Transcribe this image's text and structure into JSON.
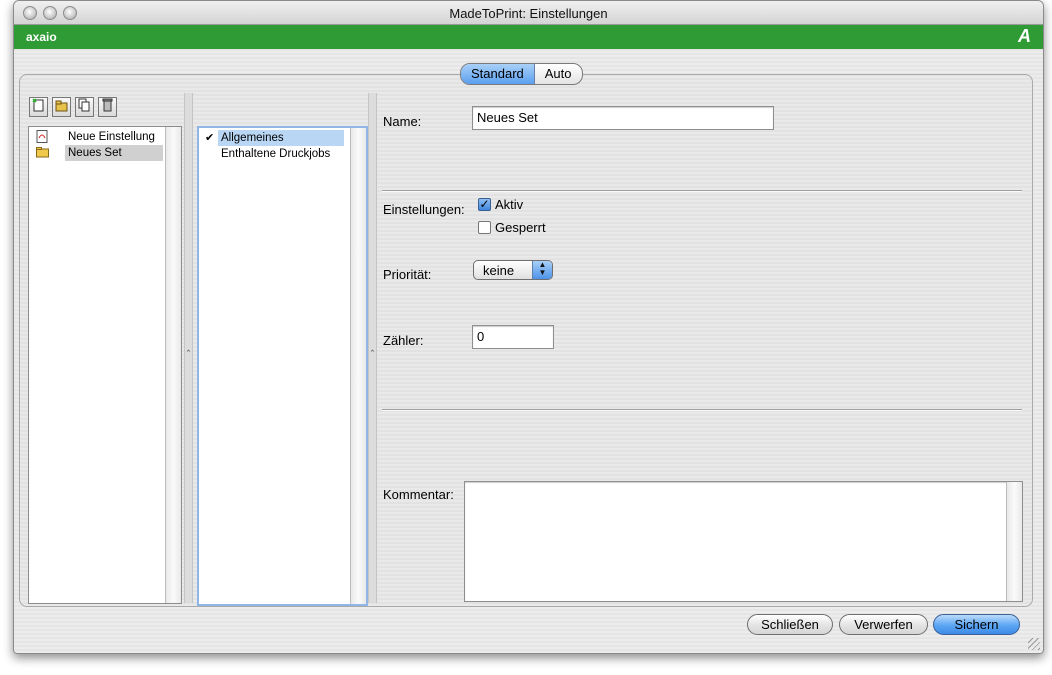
{
  "window": {
    "title": "MadeToPrint:  Einstellungen",
    "brand": "axaio",
    "brand_mark": "A",
    "accent_color": "#2f9b35"
  },
  "tabs": [
    {
      "label": "Standard",
      "selected": true
    },
    {
      "label": "Auto",
      "selected": false
    }
  ],
  "toolbar": {
    "icons": [
      "new-settings-icon",
      "new-set-icon",
      "duplicate-icon",
      "delete-icon"
    ]
  },
  "settings_list": {
    "items": [
      {
        "label": "Neue Einstellung",
        "icon": "pdf-document-icon",
        "selected": false
      },
      {
        "label": "Neues Set",
        "icon": "folder-icon",
        "selected": true
      }
    ]
  },
  "sections_list": {
    "items": [
      {
        "label": "Allgemeines",
        "checked": true,
        "selected": true
      },
      {
        "label": "Enthaltene Druckjobs",
        "checked": false,
        "selected": false
      }
    ]
  },
  "form": {
    "name_label": "Name:",
    "name_value": "Neues Set",
    "settings_label": "Einstellungen:",
    "aktiv_label": "Aktiv",
    "aktiv_checked": true,
    "gesperrt_label": "Gesperrt",
    "gesperrt_checked": false,
    "priority_label": "Priorität:",
    "priority_value": "keine",
    "counter_label": "Zähler:",
    "counter_value": "0",
    "comment_label": "Kommentar:",
    "comment_value": ""
  },
  "buttons": {
    "close": "Schließen",
    "discard": "Verwerfen",
    "save": "Sichern"
  }
}
